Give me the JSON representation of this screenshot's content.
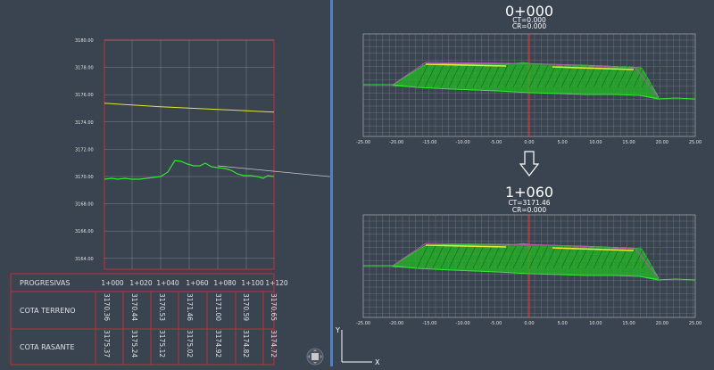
{
  "profile": {
    "y_ticks": [
      "3180.00",
      "3178.00",
      "3176.00",
      "3174.00",
      "3172.00",
      "3170.00",
      "3168.00",
      "3166.00",
      "3164.00"
    ],
    "y_values": [
      3180,
      3178,
      3176,
      3174,
      3172,
      3170,
      3168,
      3166,
      3164
    ],
    "chainages": [
      "1+000",
      "1+020",
      "1+040",
      "1+060",
      "1+080",
      "1+100",
      "1+120"
    ],
    "row_labels": {
      "progresivas": "PROGRESIVAS",
      "cota_terreno": "COTA TERRENO",
      "cota_rasante": "COTA RASANTE"
    },
    "cota_terreno": [
      "3170.36",
      "3170.44",
      "3170.53",
      "3171.46",
      "3171.00",
      "3170.59",
      "3170.65"
    ],
    "cota_rasante": [
      "3175.37",
      "3175.24",
      "3175.12",
      "3175.02",
      "3174.92",
      "3174.82",
      "3174.72"
    ],
    "colors": {
      "ground": "#33e633",
      "grade": "#e6e633",
      "border": "#c0303a",
      "grid": "#c8c8c8"
    }
  },
  "section_top": {
    "station": "0+000",
    "ct": "CT=0.000",
    "cr": "CR=0.000"
  },
  "section_bottom": {
    "station": "1+060",
    "ct": "CT=3171.46",
    "cr": "CR=0.000"
  },
  "section_axis": {
    "ticks": [
      "-25.00",
      "-20.00",
      "-15.00",
      "-10.00",
      "-5.00",
      "0.00",
      "5.00",
      "10.00",
      "15.00",
      "20.00",
      "25.00"
    ]
  },
  "ucs": {
    "y_label": "Y",
    "x_label": "X"
  },
  "arrow_icon": "down-arrow-icon",
  "nav_icon": "navigation-wheel-icon"
}
